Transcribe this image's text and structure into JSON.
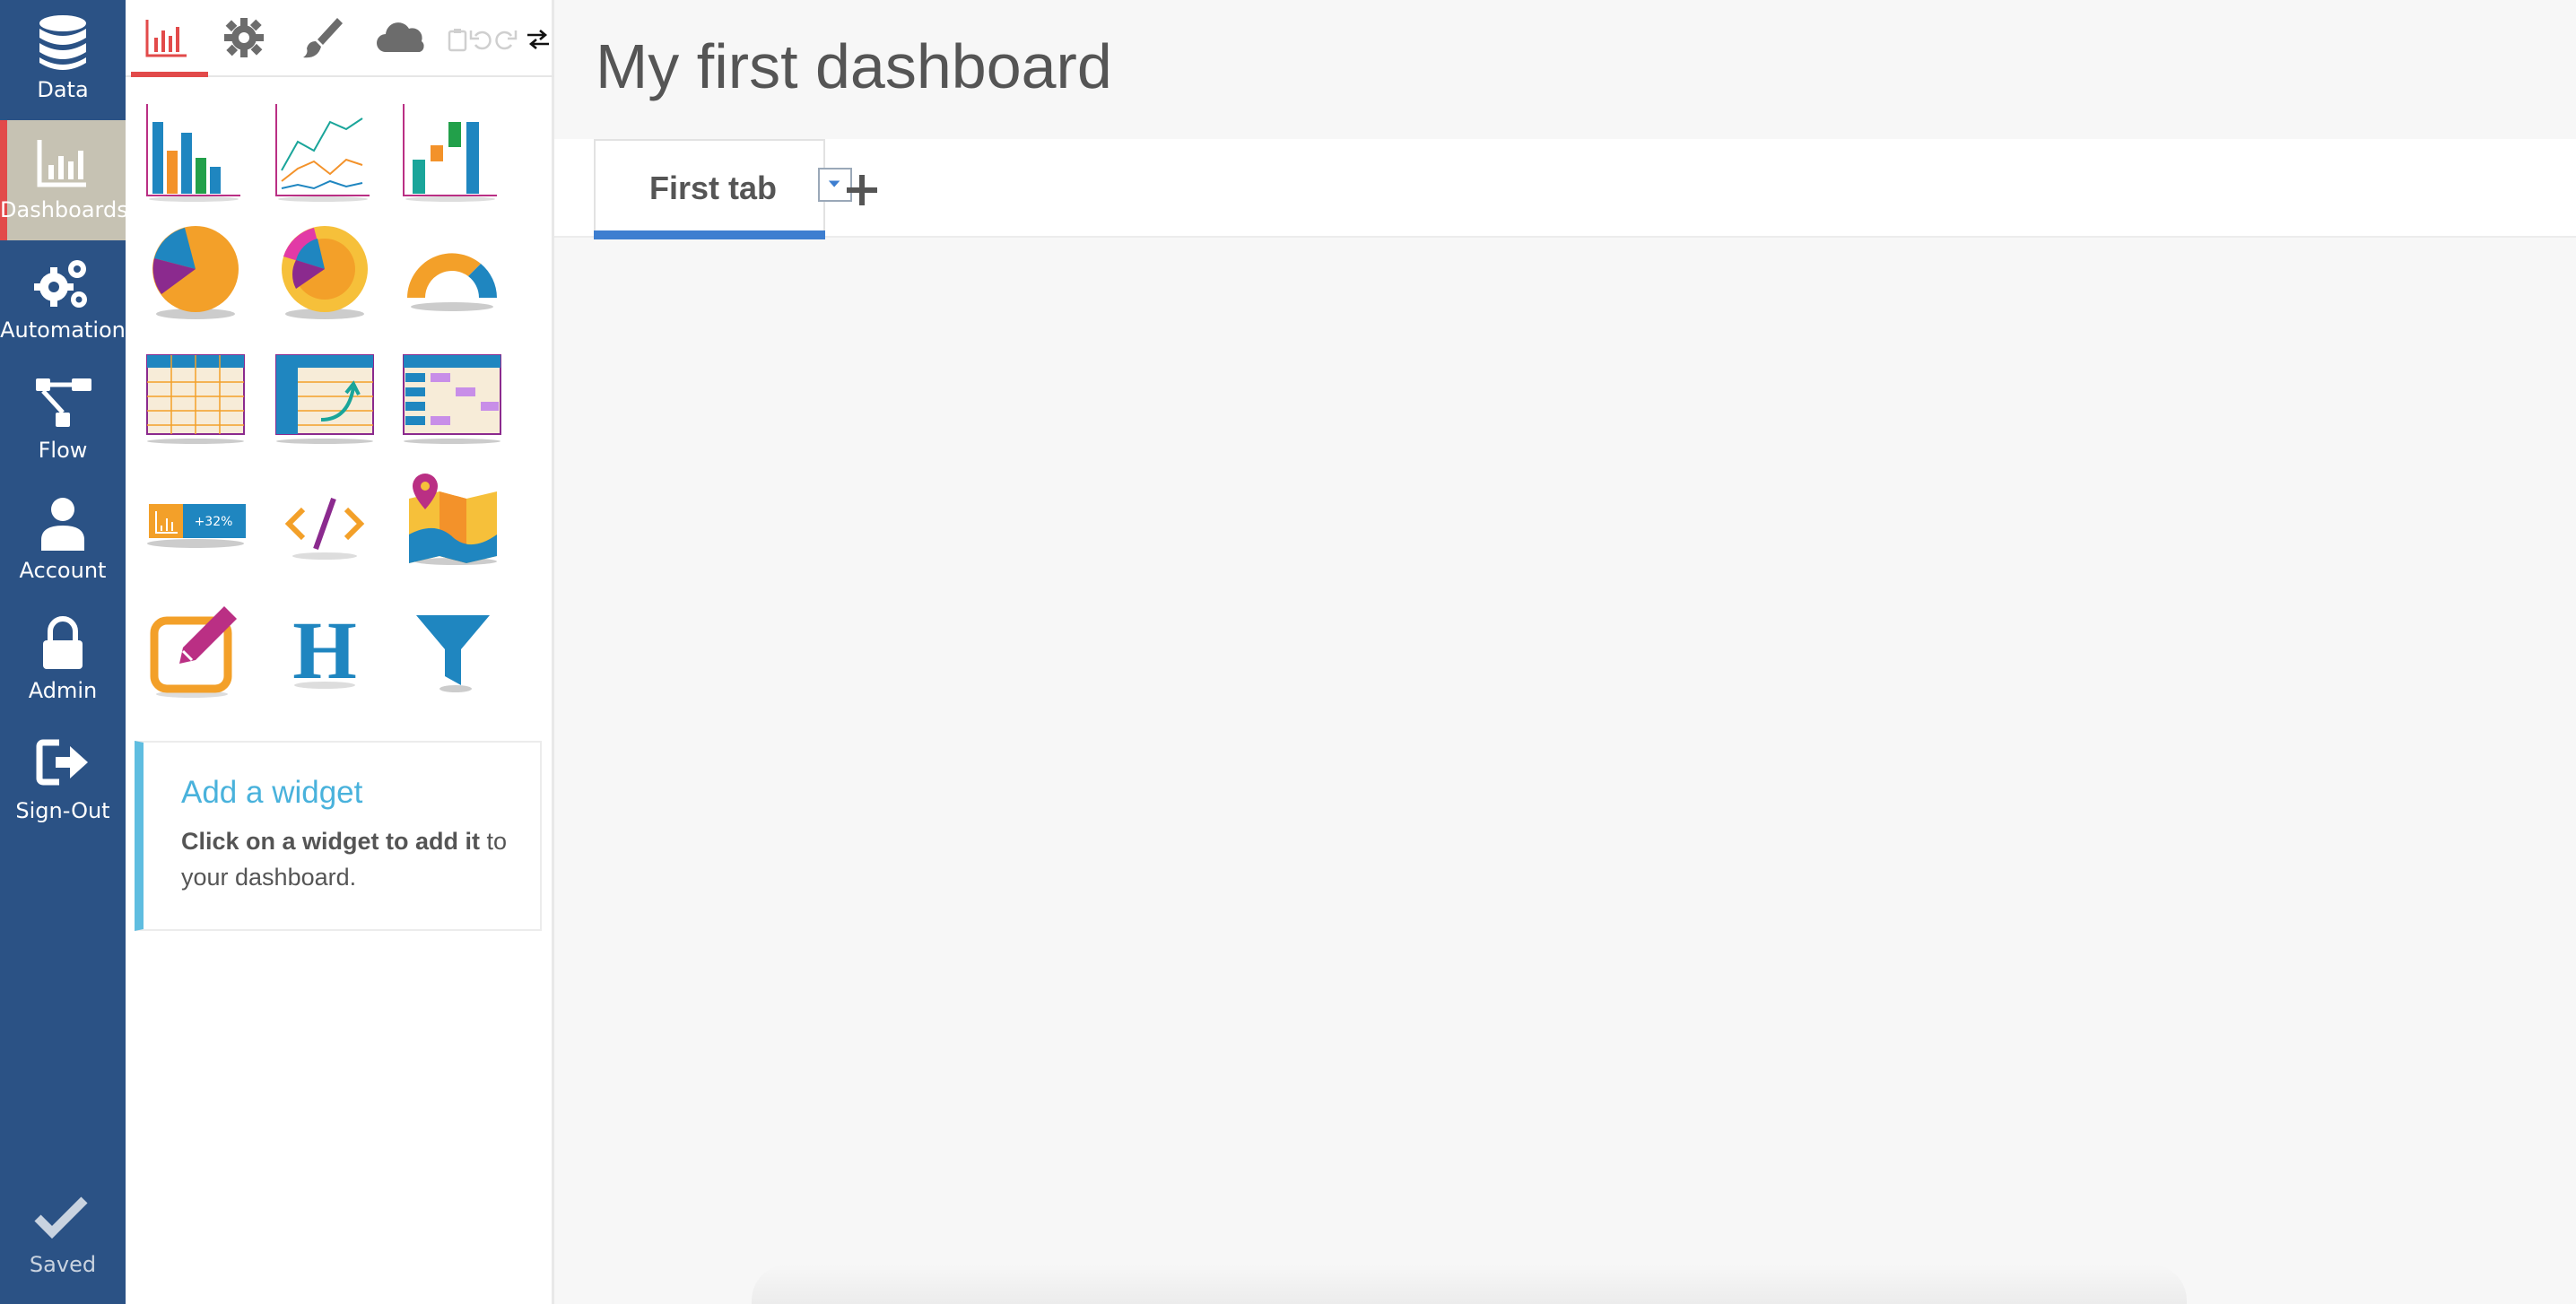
{
  "nav": {
    "items": [
      {
        "label": "Data",
        "icon": "database-icon"
      },
      {
        "label": "Dashboards",
        "icon": "bar-chart-icon",
        "active": true
      },
      {
        "label": "Automation",
        "icon": "gears-icon"
      },
      {
        "label": "Flow",
        "icon": "flow-icon"
      },
      {
        "label": "Account",
        "icon": "user-icon"
      },
      {
        "label": "Admin",
        "icon": "lock-icon"
      },
      {
        "label": "Sign-Out",
        "icon": "sign-out-icon"
      }
    ],
    "saved_label": "Saved"
  },
  "panel": {
    "tabs": [
      "chart-tab-icon",
      "settings-tab-icon",
      "brush-tab-icon",
      "cloud-tab-icon"
    ],
    "tools": [
      "clipboard-icon",
      "undo-icon",
      "redo-icon",
      "swap-icon"
    ],
    "widgets": [
      "bar-chart-widget",
      "line-chart-widget",
      "waterfall-chart-widget",
      "pie-chart-widget",
      "sunburst-chart-widget",
      "gauge-chart-widget",
      "table-widget",
      "pivot-table-widget",
      "heatmap-table-widget",
      "kpi-widget",
      "html-widget",
      "map-widget",
      "text-widget",
      "heading-widget",
      "filter-widget"
    ],
    "kpi_text": "+32%",
    "heading_glyph": "H",
    "add_widget": {
      "title": "Add a widget",
      "desc_bold": "Click on a widget to add it",
      "desc_rest": "to your dashboard."
    }
  },
  "main": {
    "title": "My first dashboard",
    "tabs": [
      {
        "label": "First tab"
      }
    ]
  },
  "colors": {
    "nav_bg": "#2b5285",
    "accent_red": "#e24a4a",
    "tab_underline": "#3d7ed0",
    "info_blue": "#49b2dc"
  }
}
